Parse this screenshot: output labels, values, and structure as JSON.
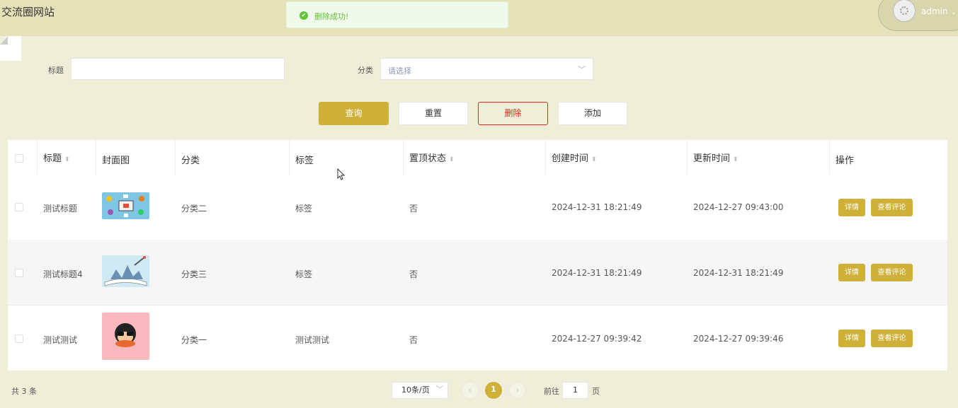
{
  "header": {
    "site_title": "交流圈网站",
    "username": "admin",
    "user_menu_caret": "⌄"
  },
  "toast": {
    "message": "删除成功!",
    "icon": "success-check-icon",
    "color": "#67c23a"
  },
  "search": {
    "title_label": "标题",
    "title_value": "",
    "category_label": "分类",
    "category_placeholder": "请选择"
  },
  "actions": {
    "query": "查询",
    "reset": "重置",
    "delete": "删除",
    "add": "添加"
  },
  "colors": {
    "accent": "#cfb13a",
    "danger": "#e0261b",
    "background": "#efefd9",
    "header": "#e5e2b9"
  },
  "table": {
    "columns": [
      "标题",
      "封面图",
      "分类",
      "标签",
      "置顶状态",
      "创建时间",
      "更新时间",
      "操作"
    ],
    "rows": [
      {
        "title": "测试标题",
        "category": "分类二",
        "tags": "标签",
        "pinned": "否",
        "created": "2024-12-31 18:21:49",
        "updated": "2024-12-27 09:43:00",
        "cover": "illustration-icons"
      },
      {
        "title": "测试标题4",
        "category": "分类三",
        "tags": "标签",
        "pinned": "否",
        "created": "2024-12-31 18:21:49",
        "updated": "2024-12-31 18:21:49",
        "cover": "book-rocket-illustration"
      },
      {
        "title": "测试测试",
        "category": "分类一",
        "tags": "测试测试",
        "pinned": "否",
        "created": "2024-12-27 09:39:42",
        "updated": "2024-12-27 09:39:46",
        "cover": "cartoon-face-illustration"
      }
    ],
    "row_actions": {
      "detail": "详情",
      "comments": "查看评论"
    }
  },
  "pagination": {
    "total": "共 3 条",
    "page_size": "10条/页",
    "prev": "‹",
    "current": "1",
    "next": "›",
    "goto_prefix": "前往",
    "goto_value": "1",
    "goto_suffix": "页"
  }
}
